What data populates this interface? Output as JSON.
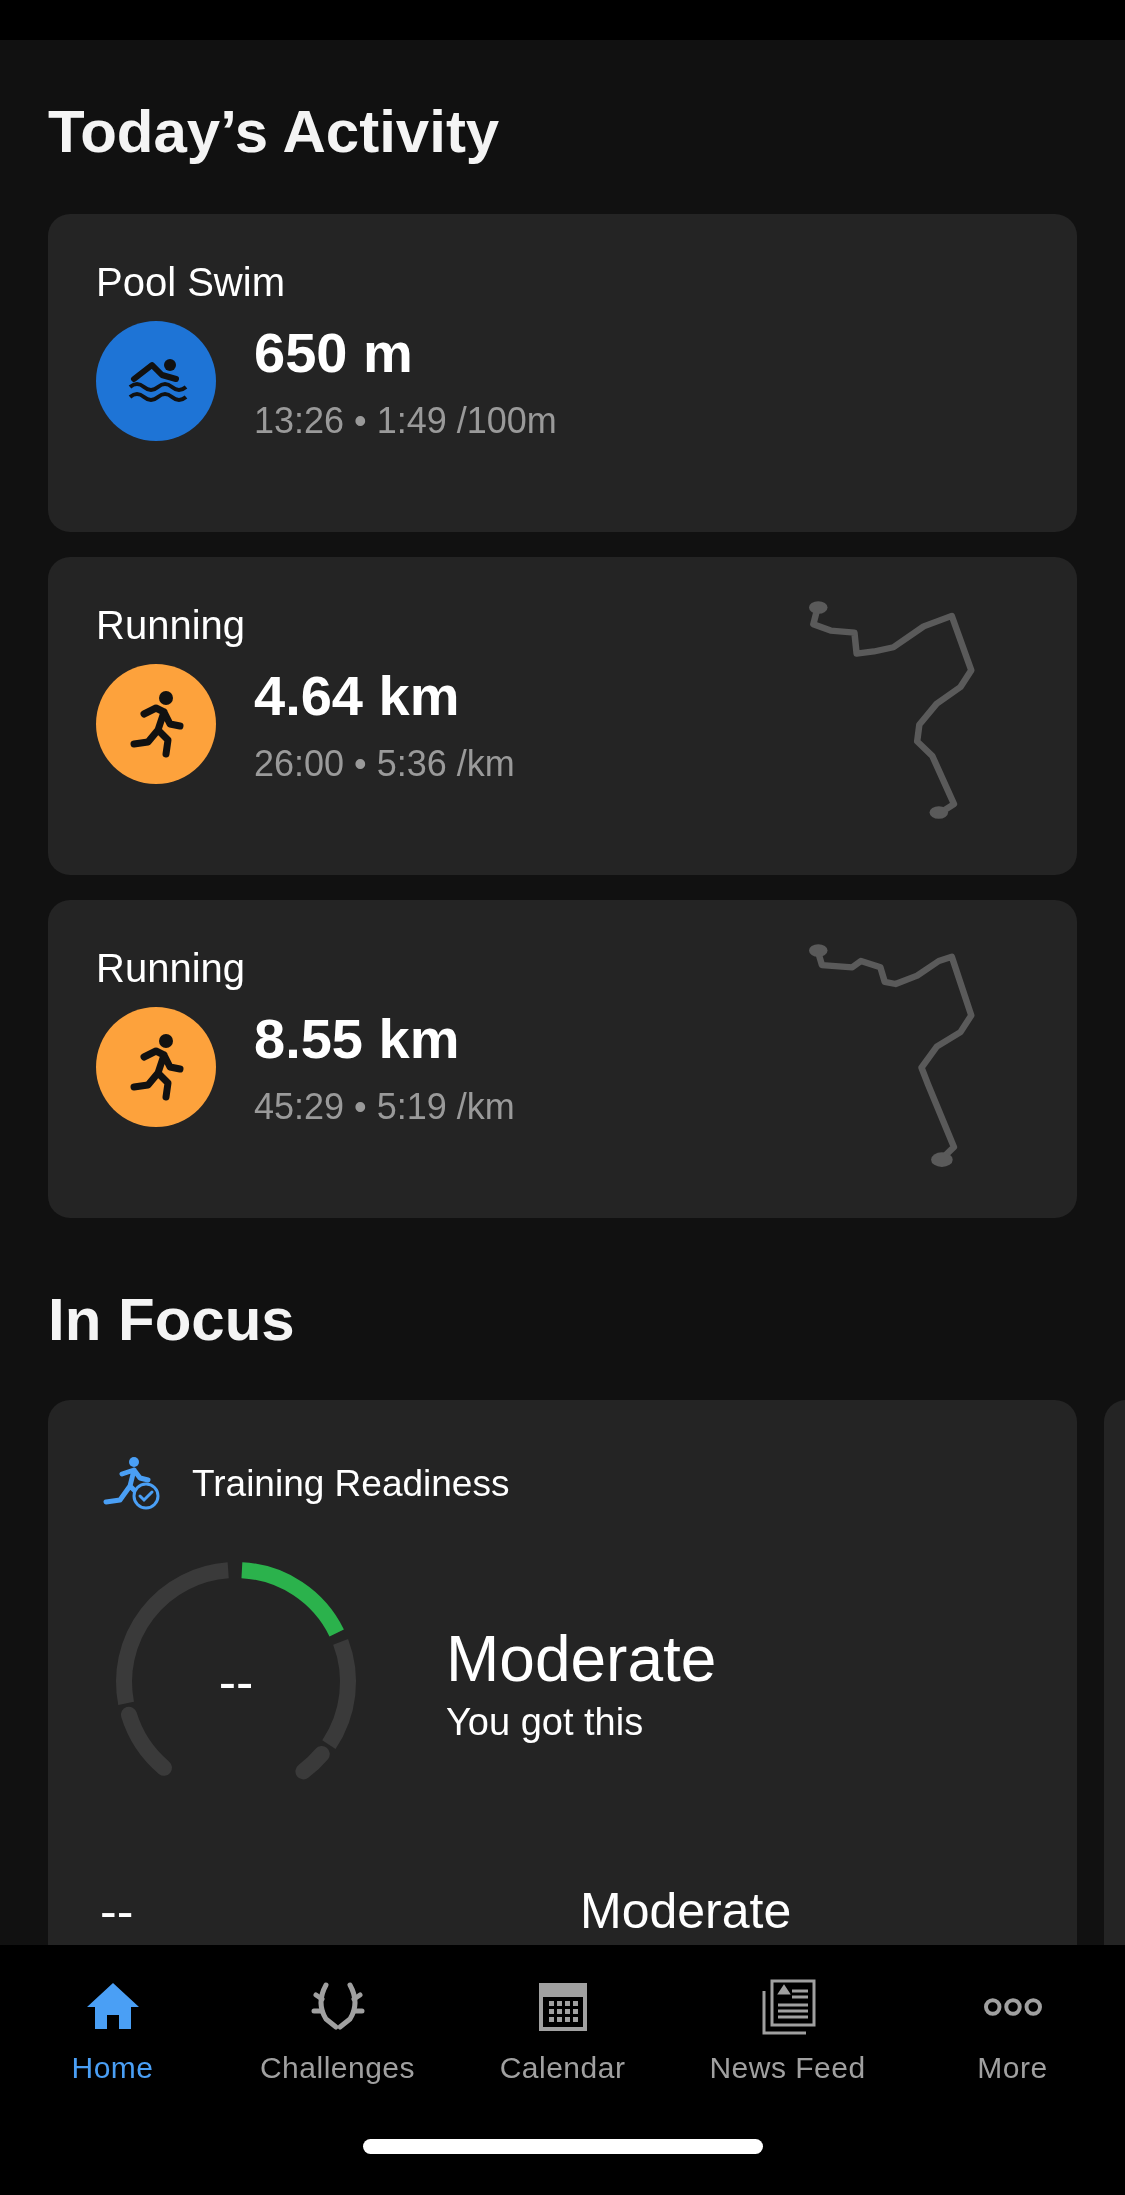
{
  "today": {
    "heading": "Today’s Activity",
    "activities": [
      {
        "kind": "swim",
        "title": "Pool Swim",
        "color": "#1e74d6",
        "distance": "650 m",
        "stats": "13:26 • 1:49 /100m",
        "has_route": false
      },
      {
        "kind": "run",
        "title": "Running",
        "color": "#fda23c",
        "distance": "4.64 km",
        "stats": "26:00 • 5:36 /km",
        "has_route": true
      },
      {
        "kind": "run",
        "title": "Running",
        "color": "#fda23c",
        "distance": "8.55 km",
        "stats": "45:29 • 5:19 /km",
        "has_route": true
      }
    ]
  },
  "in_focus": {
    "heading": "In Focus",
    "card": {
      "title": "Training Readiness",
      "score": "--",
      "status": "Moderate",
      "message": "You got this",
      "row_left": "--",
      "row_right": "Moderate"
    }
  },
  "tab_bar": [
    {
      "kind": "home",
      "label": "Home",
      "selected": true
    },
    {
      "kind": "challenges",
      "label": "Challenges",
      "selected": false
    },
    {
      "kind": "calendar",
      "label": "Calendar",
      "selected": false
    },
    {
      "kind": "news",
      "label": "News Feed",
      "selected": false
    },
    {
      "kind": "more",
      "label": "More",
      "selected": false
    }
  ]
}
